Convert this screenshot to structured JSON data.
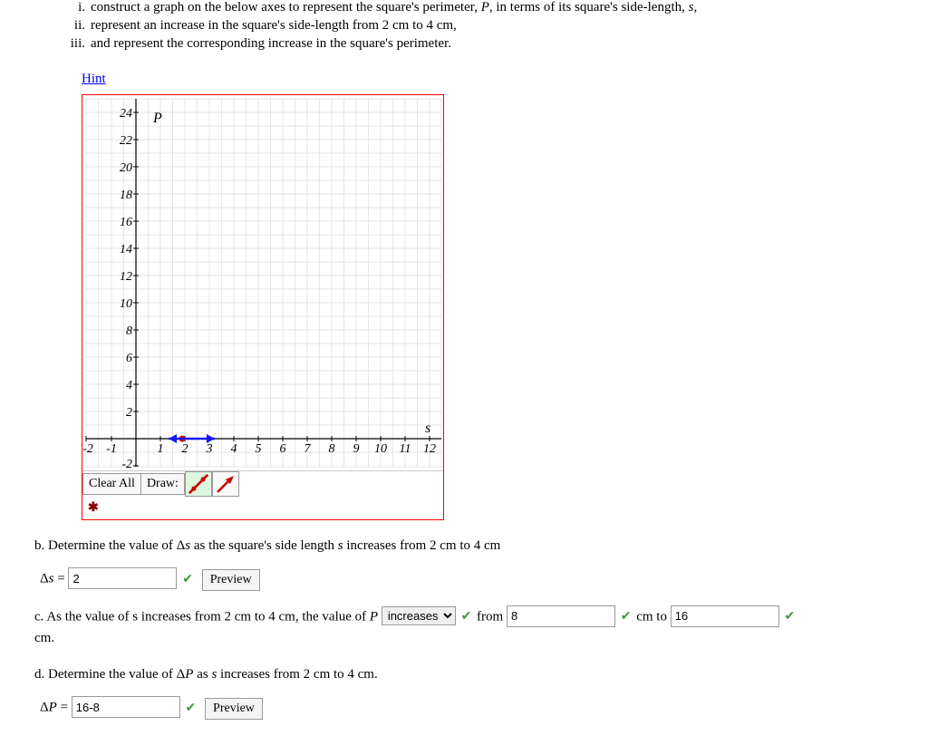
{
  "bullets": {
    "i": {
      "roman": "i.",
      "text_a": "construct a graph on the below axes to represent the square's perimeter, ",
      "P": "P",
      "text_b": ", in terms of its square's side-length, ",
      "s": "s",
      "text_c": ","
    },
    "ii": {
      "roman": "ii.",
      "text": "represent an increase in the square's side-length from 2 cm to 4 cm,"
    },
    "iii": {
      "roman": "iii.",
      "text": "and represent the corresponding increase in the square's perimeter."
    }
  },
  "hint_label": "Hint",
  "graph": {
    "y_ticks": [
      24,
      22,
      20,
      18,
      16,
      14,
      12,
      10,
      8,
      6,
      4,
      2,
      -2
    ],
    "x_ticks": [
      -2,
      -1,
      1,
      2,
      3,
      4,
      5,
      6,
      7,
      8,
      9,
      10,
      11,
      12
    ],
    "y_axis_label": "P",
    "x_axis_label": "s"
  },
  "toolbar": {
    "clear_all": "Clear All",
    "draw": "Draw:"
  },
  "part_b": {
    "text_a": "b. Determine the value of Δ",
    "s": "s",
    "text_b": " as the square's side length ",
    "s2": "s",
    "text_c": " increases from 2 cm to 4 cm"
  },
  "delta_s_label_a": "Δ",
  "delta_s_label_b": "s",
  "delta_s_eq": " = ",
  "delta_s_value": "2",
  "preview_label": "Preview",
  "part_c": {
    "text_a": "c. As the value of s increases from 2 cm to 4 cm, the value of ",
    "P": "P",
    "select_value": "increases",
    "from": " from ",
    "from_value": "8",
    "cmto": " cm to ",
    "to_value": "16",
    "cm_suffix": "cm."
  },
  "part_d": {
    "text_a": "d. Determine the value of Δ",
    "P": "P",
    "text_b": " as ",
    "s": "s",
    "text_c": " increases from 2 cm to 4 cm."
  },
  "delta_P_label_a": "Δ",
  "delta_P_label_b": "P",
  "delta_P_eq": " = ",
  "delta_P_value": "16-8",
  "chart_data": {
    "type": "scatter",
    "title": "",
    "xlabel": "s",
    "ylabel": "P",
    "xlim": [
      -2,
      12
    ],
    "ylim": [
      -2,
      24
    ],
    "x_majors": [
      -2,
      -1,
      1,
      2,
      3,
      4,
      5,
      6,
      7,
      8,
      9,
      10,
      11,
      12
    ],
    "y_majors": [
      -2,
      2,
      4,
      6,
      8,
      10,
      12,
      14,
      16,
      18,
      20,
      22,
      24
    ],
    "series": [
      {
        "name": "user-drawn-segment",
        "type": "line-segment-with-arrows",
        "x": [
          1.9,
          3.2
        ],
        "y": [
          0,
          0
        ],
        "color_left": "blue",
        "color_right": "red"
      }
    ]
  }
}
